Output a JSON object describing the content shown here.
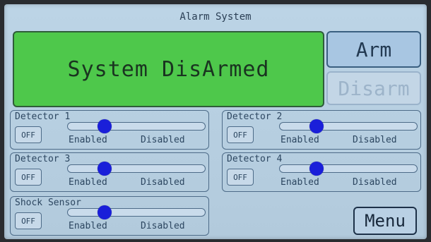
{
  "title": "Alarm System",
  "status": {
    "text": "System DisArmed",
    "color": "#4ec84b"
  },
  "buttons": {
    "arm": "Arm",
    "disarm": "Disarm",
    "menu": "Menu"
  },
  "detectors": [
    {
      "name": "Detector 1",
      "off_label": "OFF",
      "enabled_label": "Enabled",
      "disabled_label": "Disabled",
      "slider_value": 0.27
    },
    {
      "name": "Detector 2",
      "off_label": "OFF",
      "enabled_label": "Enabled",
      "disabled_label": "Disabled",
      "slider_value": 0.27
    },
    {
      "name": "Detector 3",
      "off_label": "OFF",
      "enabled_label": "Enabled",
      "disabled_label": "Disabled",
      "slider_value": 0.27
    },
    {
      "name": "Detector 4",
      "off_label": "OFF",
      "enabled_label": "Enabled",
      "disabled_label": "Disabled",
      "slider_value": 0.27
    },
    {
      "name": "Shock Sensor",
      "off_label": "OFF",
      "enabled_label": "Enabled",
      "disabled_label": "Disabled",
      "slider_value": 0.27
    }
  ],
  "colors": {
    "slider_knob": "#1a1fd9",
    "screen_bg": "#bcd4e6"
  }
}
